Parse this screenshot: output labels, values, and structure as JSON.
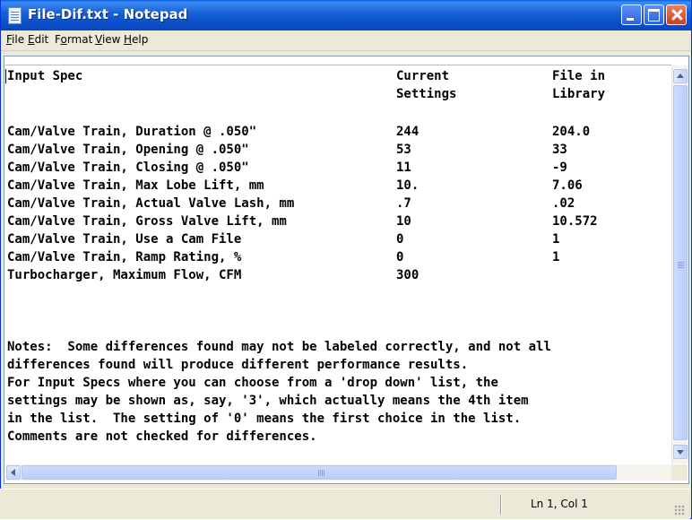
{
  "window": {
    "title": "File-Dif.txt - Notepad"
  },
  "menu": [
    {
      "accel": "F",
      "rest": "ile"
    },
    {
      "accel": "E",
      "rest": "dit"
    },
    {
      "pre": "F",
      "accel": "o",
      "rest": "rmat"
    },
    {
      "accel": "V",
      "rest": "iew"
    },
    {
      "accel": "H",
      "rest": "elp"
    }
  ],
  "header": {
    "col1": "Input Spec",
    "col2_line1": "Current",
    "col2_line2": "Settings",
    "col3_line1": "File in",
    "col3_line2": "Library"
  },
  "rows": [
    {
      "spec": "Cam/Valve Train, Duration @ .050\"",
      "current": "244",
      "library": "204.0"
    },
    {
      "spec": "Cam/Valve Train, Opening @ .050\"",
      "current": "53",
      "library": "33"
    },
    {
      "spec": "Cam/Valve Train, Closing @ .050\"",
      "current": "11",
      "library": "-9"
    },
    {
      "spec": "Cam/Valve Train, Max Lobe Lift, mm",
      "current": "10.",
      "library": "7.06"
    },
    {
      "spec": "Cam/Valve Train, Actual Valve Lash, mm",
      "current": ".7",
      "library": ".02"
    },
    {
      "spec": "Cam/Valve Train, Gross Valve Lift, mm",
      "current": "10",
      "library": "10.572"
    },
    {
      "spec": "Cam/Valve Train, Use a Cam File",
      "current": "0",
      "library": "1"
    },
    {
      "spec": "Cam/Valve Train, Ramp Rating, %",
      "current": "0",
      "library": "1"
    },
    {
      "spec": "Turbocharger, Maximum Flow, CFM",
      "current": "300",
      "library": ""
    }
  ],
  "notes": [
    "Notes:  Some differences found may not be labeled correctly, and not all",
    "differences found will produce different performance results.",
    "For Input Specs where you can choose from a 'drop down' list, the",
    "settings may be shown as, say, '3', which actually means the 4th item",
    "in the list.  The setting of '0' means the first choice in the list.",
    "Comments are not checked for differences."
  ],
  "status": {
    "position": "Ln 1, Col 1"
  }
}
